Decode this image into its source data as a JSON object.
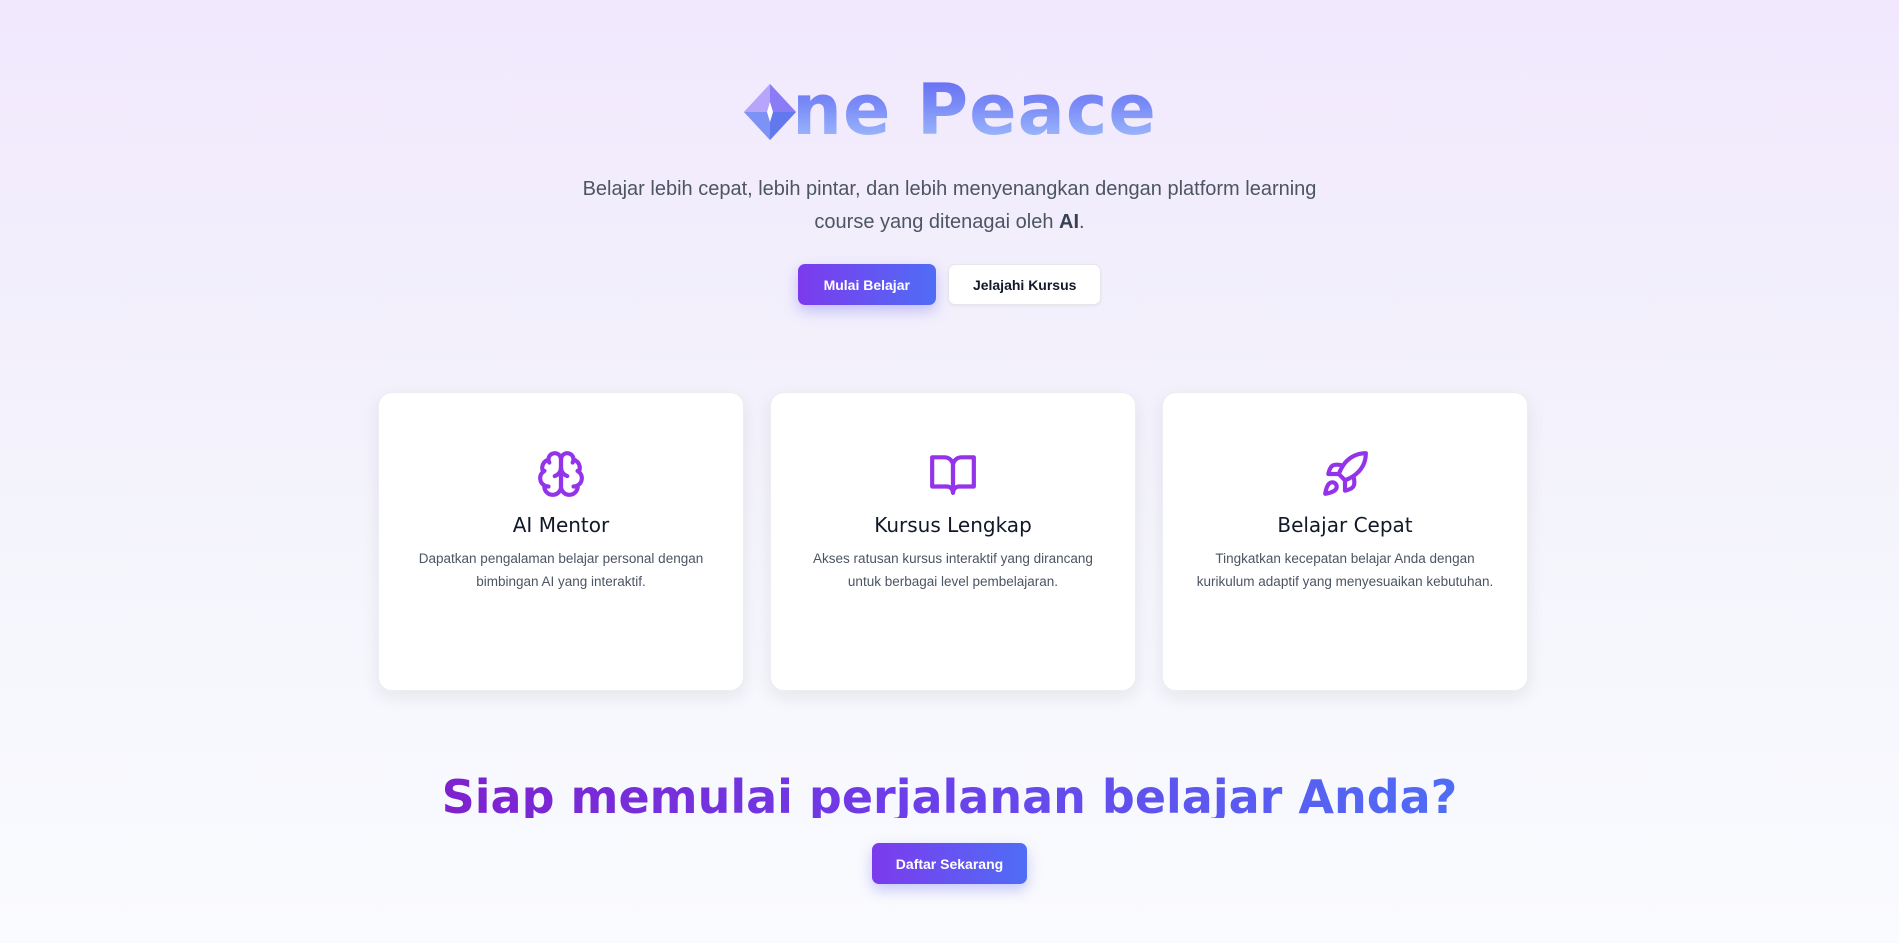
{
  "brand": {
    "name": "ne Peace",
    "logo_icon": "diamond-logo-icon"
  },
  "hero": {
    "subtitle_main": "Belajar lebih cepat, lebih pintar, dan lebih menyenangkan dengan platform learning course yang ditenagai oleh ",
    "subtitle_highlight": "AI",
    "subtitle_end": ".",
    "primary_button": "Mulai Belajar",
    "secondary_button": "Jelajahi Kursus"
  },
  "features": [
    {
      "icon": "brain-icon",
      "title": "AI Mentor",
      "description": "Dapatkan pengalaman belajar personal dengan bimbingan AI yang interaktif."
    },
    {
      "icon": "book-open-icon",
      "title": "Kursus Lengkap",
      "description": "Akses ratusan kursus interaktif yang dirancang untuk berbagai level pembelajaran."
    },
    {
      "icon": "rocket-icon",
      "title": "Belajar Cepat",
      "description": "Tingkatkan kecepatan belajar Anda dengan kurikulum adaptif yang menyesuaikan kebutuhan."
    }
  ],
  "cta": {
    "title": "Siap memulai perjalanan belajar Anda?",
    "button": "Daftar Sekarang"
  },
  "colors": {
    "accent_purple": "#7c3aed",
    "accent_blue": "#4f6df5",
    "icon_purple": "#9333ea"
  }
}
